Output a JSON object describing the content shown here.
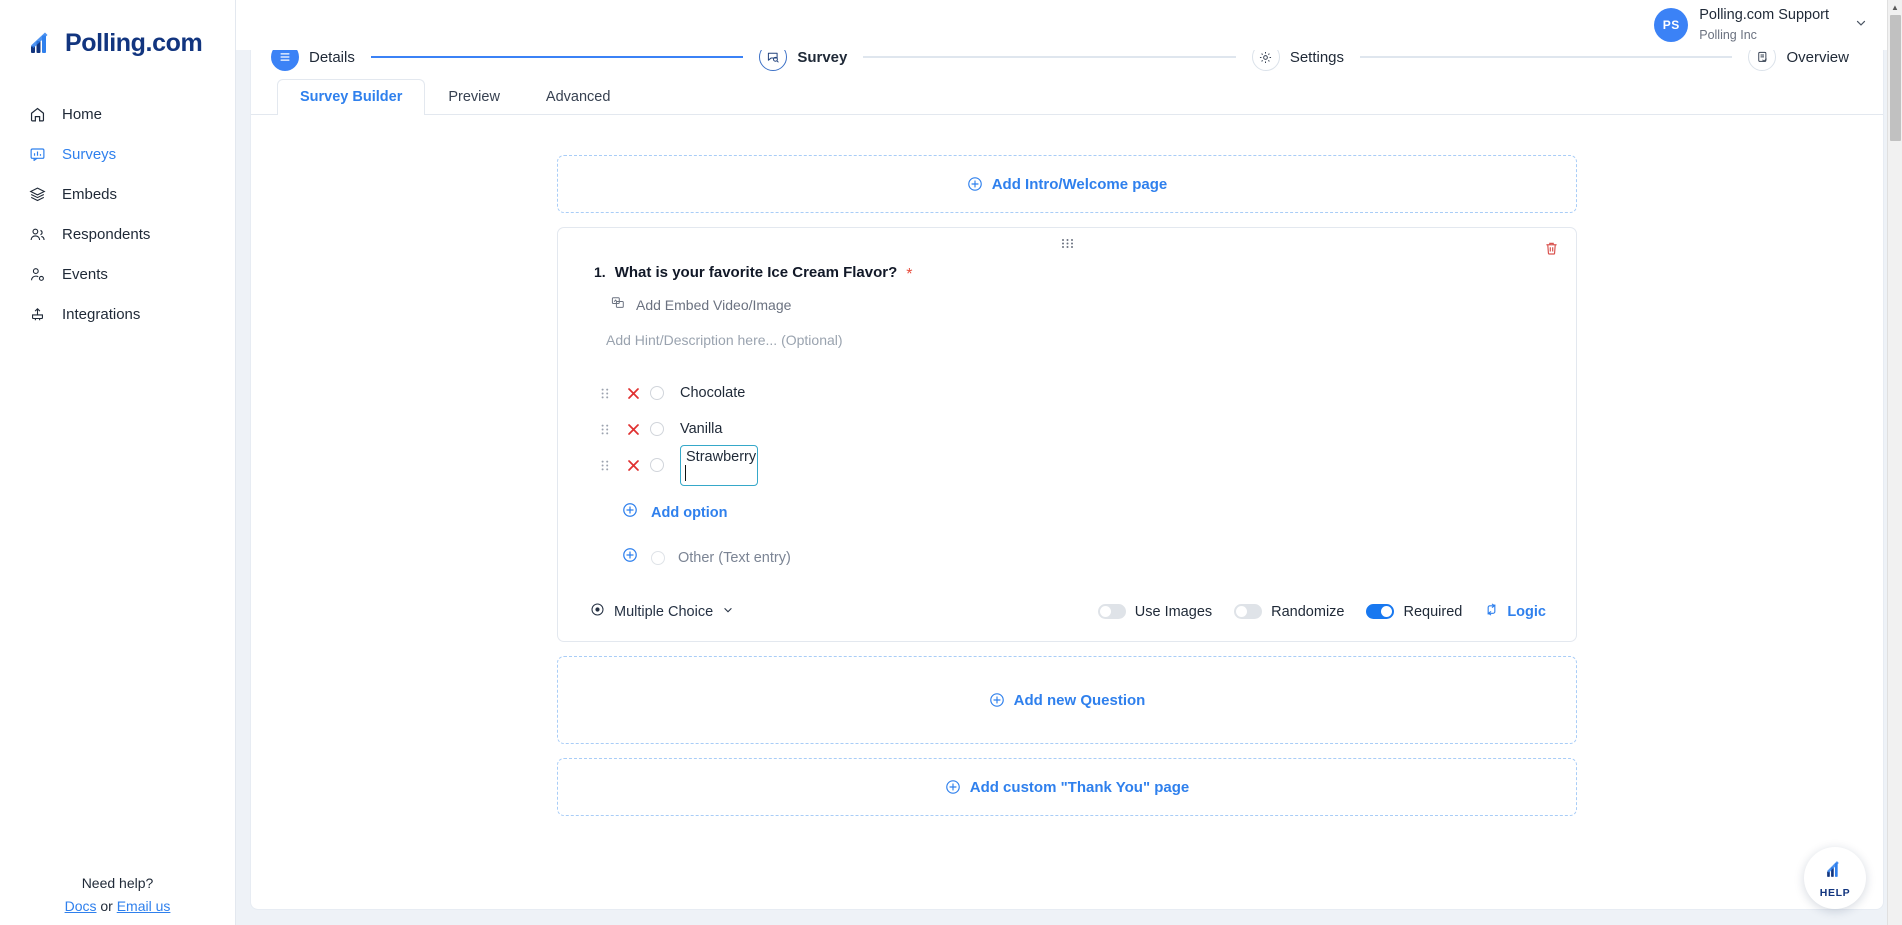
{
  "brand": {
    "name": "Polling.com",
    "logo_icon": "polling-bars-logo"
  },
  "sidebar": {
    "items": [
      {
        "label": "Home",
        "icon": "home-icon",
        "active": false
      },
      {
        "label": "Surveys",
        "icon": "survey-icon",
        "active": true
      },
      {
        "label": "Embeds",
        "icon": "layers-icon",
        "active": false
      },
      {
        "label": "Respondents",
        "icon": "users-icon",
        "active": false
      },
      {
        "label": "Events",
        "icon": "user-gear-icon",
        "active": false
      },
      {
        "label": "Integrations",
        "icon": "plug-upload-icon",
        "active": false
      }
    ],
    "help": {
      "title": "Need help?",
      "docs_label": "Docs",
      "or_label": "or",
      "email_label": "Email us"
    }
  },
  "topbar": {
    "user": {
      "initials": "PS",
      "name": "Polling.com Support",
      "org": "Polling Inc",
      "caret_icon": "chevron-down-icon"
    }
  },
  "stepper": {
    "steps": [
      {
        "label": "Details",
        "icon": "list-icon",
        "state": "done"
      },
      {
        "label": "Survey",
        "icon": "survey-search-icon",
        "state": "current"
      },
      {
        "label": "Settings",
        "icon": "gear-icon",
        "state": "todo"
      },
      {
        "label": "Overview",
        "icon": "document-check-icon",
        "state": "todo"
      }
    ]
  },
  "tabs": [
    {
      "label": "Survey Builder",
      "active": true
    },
    {
      "label": "Preview",
      "active": false
    },
    {
      "label": "Advanced",
      "active": false
    }
  ],
  "builder": {
    "intro_box": {
      "label": "Add Intro/Welcome page",
      "icon": "plus-circle-icon"
    },
    "new_question_box": {
      "label": "Add new Question",
      "icon": "plus-circle-icon"
    },
    "thank_you_box": {
      "label": "Add custom \"Thank You\" page",
      "icon": "plus-circle-icon"
    },
    "question": {
      "drag_handle_icon": "drag-dots-icon",
      "delete_icon": "trash-icon",
      "number": "1.",
      "title": "What is your favorite Ice Cream Flavor?",
      "required_marker": "*",
      "embed_label": "Add Embed Video/Image",
      "embed_icon": "media-embed-icon",
      "hint_placeholder": "Add Hint/Description here... (Optional)",
      "options": [
        {
          "label": "Chocolate",
          "editing": false
        },
        {
          "label": "Vanilla",
          "editing": false
        },
        {
          "label": "Strawberry",
          "editing": true
        }
      ],
      "add_option_label": "Add option",
      "add_option_icon": "plus-circle-icon",
      "other_label": "Other (Text entry)",
      "other_icon": "plus-circle-icon",
      "type_label": "Multiple Choice",
      "type_icon": "radio-dot-icon",
      "type_caret_icon": "chevron-down-icon",
      "toggles": [
        {
          "label": "Use Images",
          "on": false
        },
        {
          "label": "Randomize",
          "on": false
        },
        {
          "label": "Required",
          "on": true
        }
      ],
      "logic_label": "Logic",
      "logic_icon": "branch-logic-icon"
    }
  },
  "help_fab": {
    "label": "HELP",
    "icon": "polling-bars-logo"
  },
  "colors": {
    "accent": "#2f80ed",
    "brand_navy": "#12357f",
    "toggle_on": "#1878f0",
    "danger": "#e03131",
    "canvas": "#eef2f7",
    "dashed_border": "#a9cdf7",
    "input_focus": "#36a8c9"
  }
}
